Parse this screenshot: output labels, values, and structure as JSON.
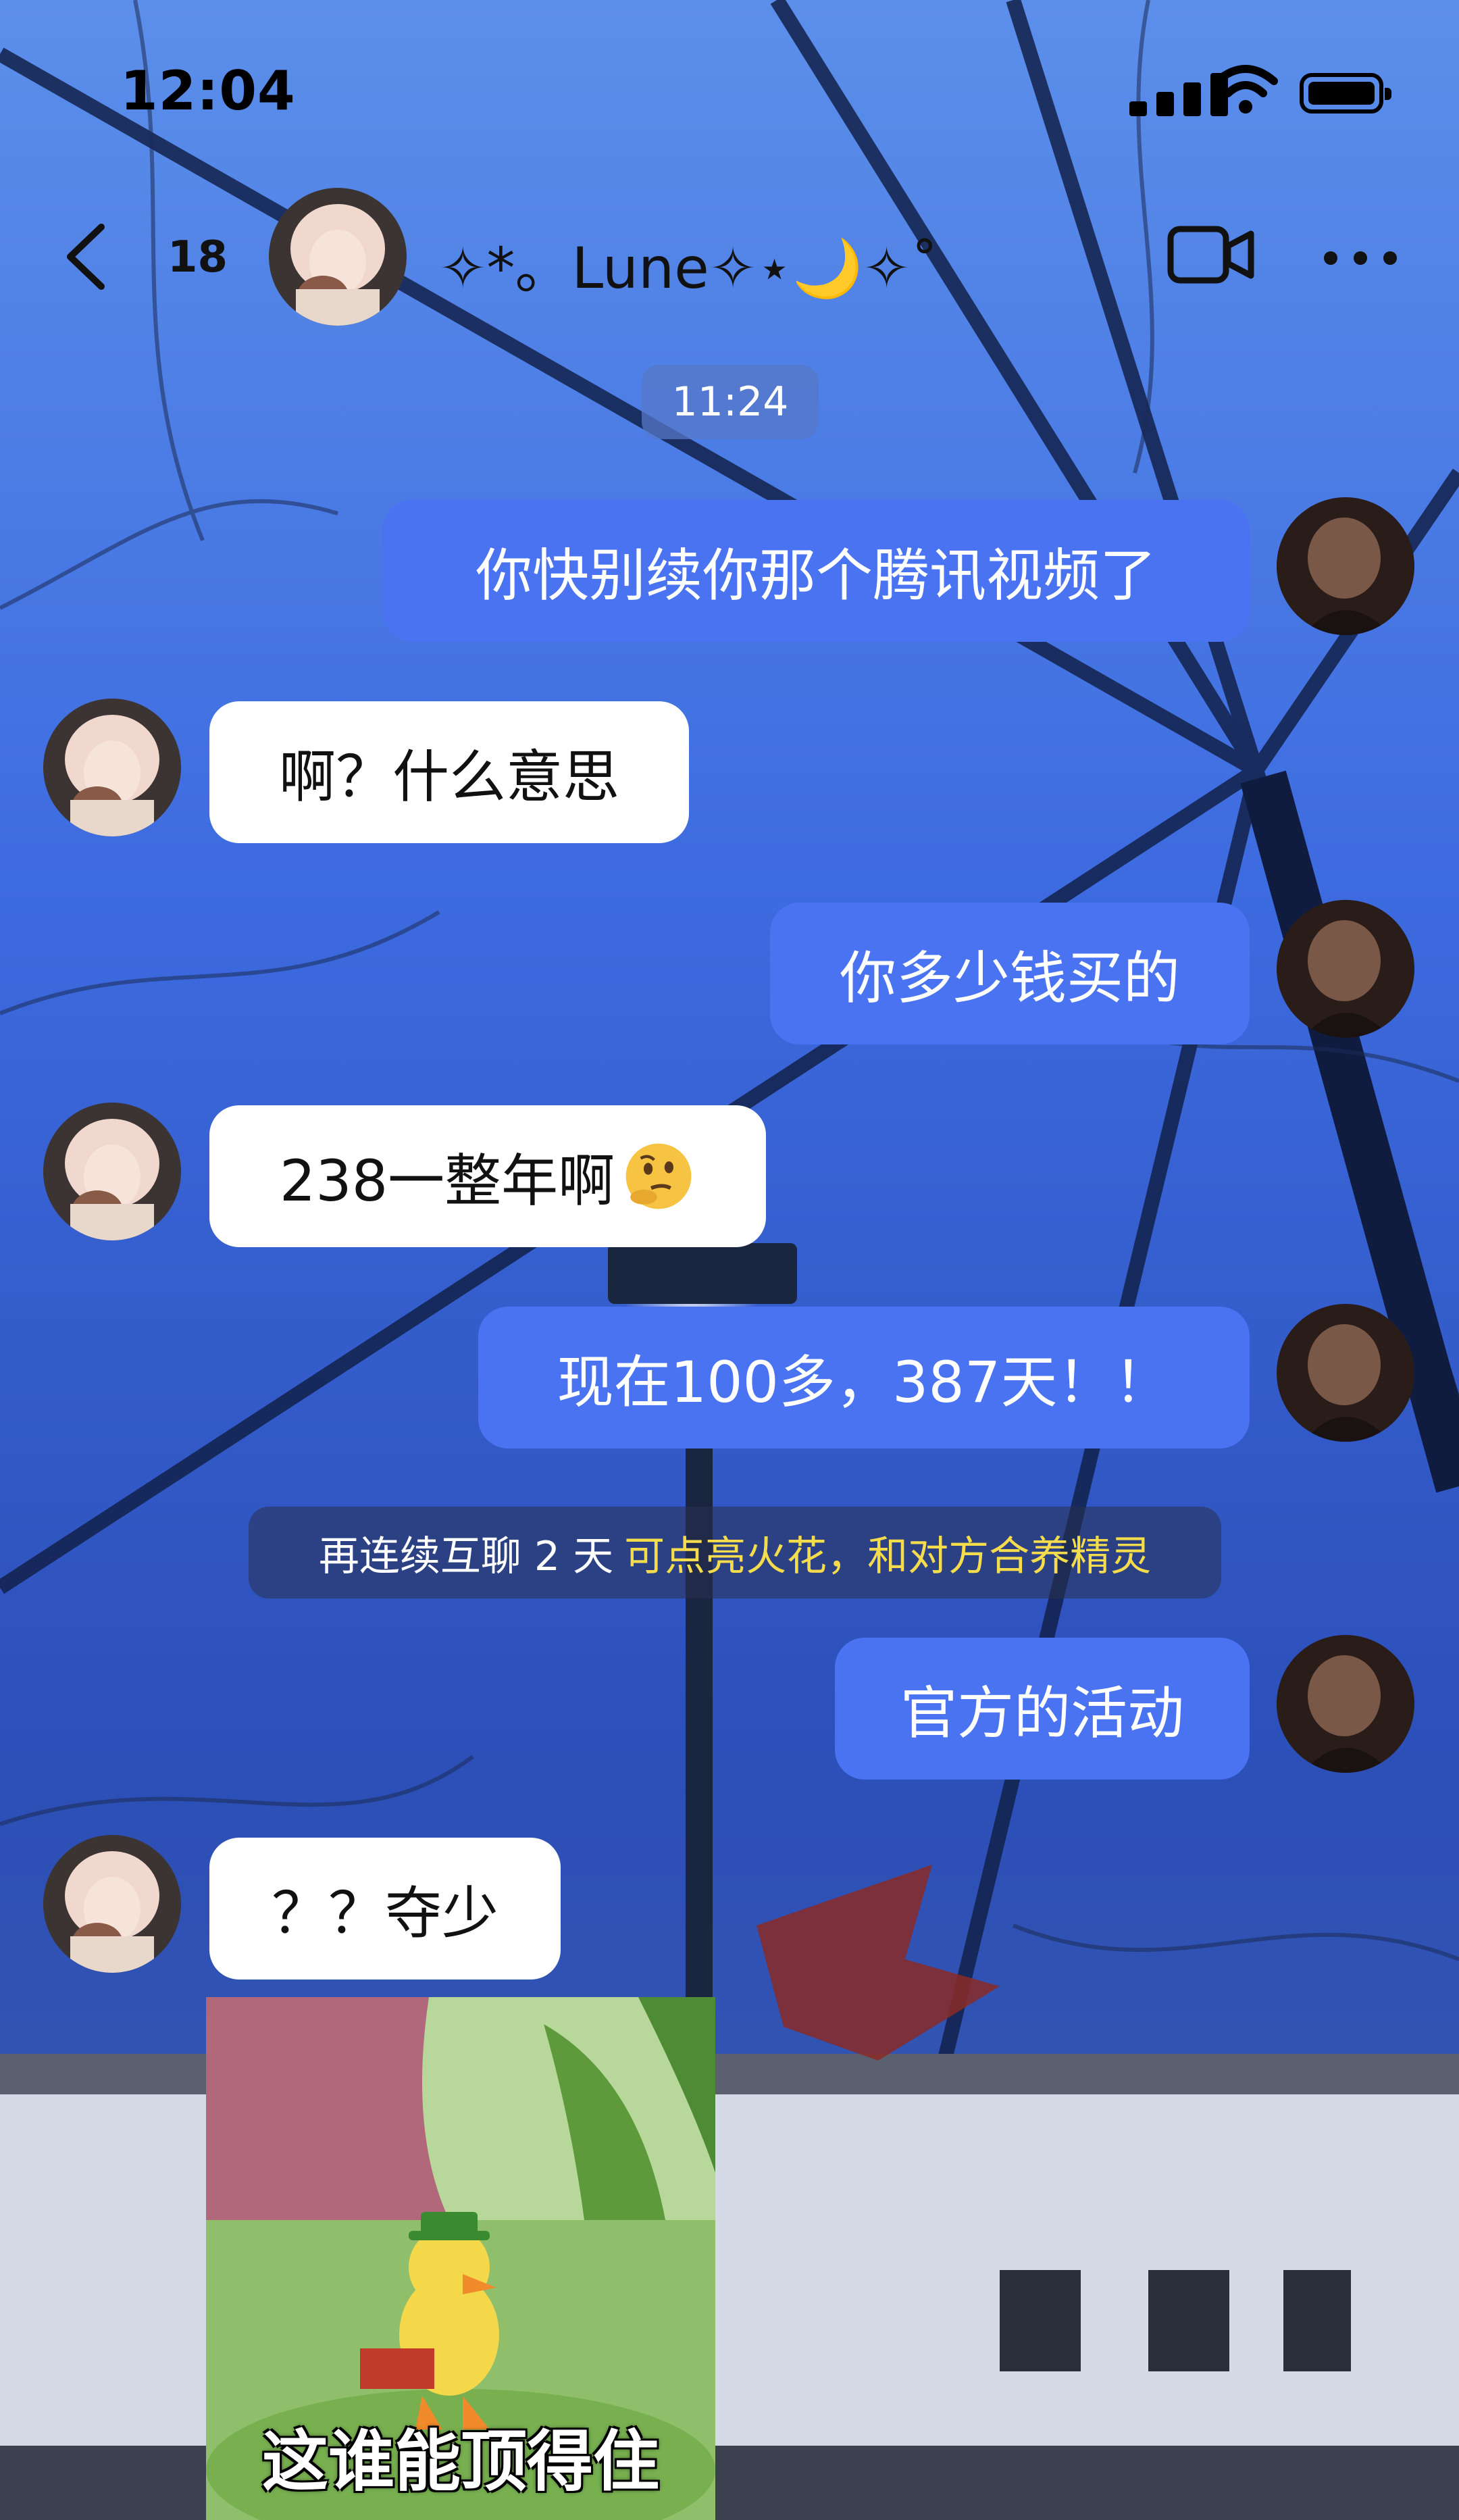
{
  "status_bar": {
    "time": "12:04"
  },
  "header": {
    "unread_count": "18",
    "contact_name": "✧*。Lune✧⋆🌙✧˚"
  },
  "timestamp": "11:24",
  "messages": [
    {
      "from": "me",
      "text": "你快别续你那个腾讯视频了"
    },
    {
      "from": "them",
      "text": "啊？什么意思"
    },
    {
      "from": "me",
      "text": "你多少钱买的"
    },
    {
      "from": "them",
      "text": "238一整年啊",
      "emoji": "thinking-face-icon"
    },
    {
      "from": "me",
      "text": "现在100多，387天！！"
    },
    {
      "from": "me",
      "text": "官方的活动"
    },
    {
      "from": "them",
      "text": "？？夺少"
    }
  ],
  "notice": {
    "text": "再连续互聊 2 天",
    "highlight": "可点亮火花，和对方合养精灵"
  },
  "sticker": {
    "caption": "这谁能顶得住"
  },
  "icons": [
    "back-chevron-icon",
    "video-call-icon",
    "more-icon",
    "signal-icon",
    "wifi-icon",
    "battery-icon",
    "thinking-face-icon"
  ],
  "colors": {
    "my_bubble": "#4a73f2",
    "their_bubble": "#ffffff",
    "notice_highlight": "#f4dc4c"
  }
}
